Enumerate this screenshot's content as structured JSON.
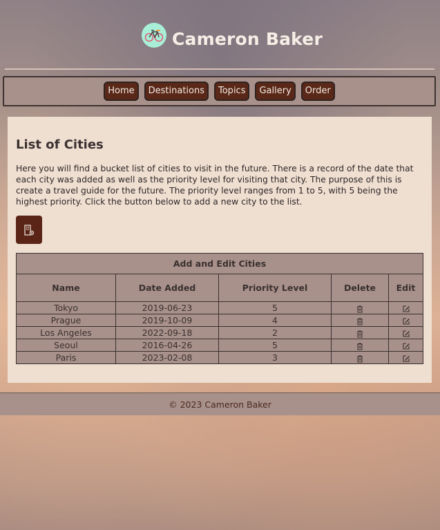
{
  "header": {
    "site_title": "Cameron Baker"
  },
  "nav": {
    "items": [
      {
        "label": "Home"
      },
      {
        "label": "Destinations"
      },
      {
        "label": "Topics"
      },
      {
        "label": "Gallery"
      },
      {
        "label": "Order"
      }
    ]
  },
  "main": {
    "title": "List of Cities",
    "intro": "Here you will find a bucket list of cities to visit in the future. There is a record of the date that each city was added as well as the priority level for visiting that city. The purpose of this is create a travel guide for the future. The priority level ranges from 1 to 5, with 5 being the highest priority. Click the button below to add a new city to the list.",
    "add_button_icon": "building-add-icon"
  },
  "table": {
    "caption": "Add and Edit Cities",
    "columns": [
      "Name",
      "Date Added",
      "Priority Level",
      "Delete",
      "Edit"
    ],
    "rows": [
      {
        "name": "Tokyo",
        "date": "2019-06-23",
        "priority": "5"
      },
      {
        "name": "Prague",
        "date": "2019-10-09",
        "priority": "4"
      },
      {
        "name": "Los Angeles",
        "date": "2022-09-18",
        "priority": "2"
      },
      {
        "name": "Seoul",
        "date": "2016-04-26",
        "priority": "5"
      },
      {
        "name": "Paris",
        "date": "2023-02-08",
        "priority": "3"
      }
    ]
  },
  "footer": {
    "text": "© 2023 Cameron Baker"
  },
  "colors": {
    "accent": "#5a2818",
    "panel": "#a8918a",
    "content_bg": "#efdfd1"
  }
}
